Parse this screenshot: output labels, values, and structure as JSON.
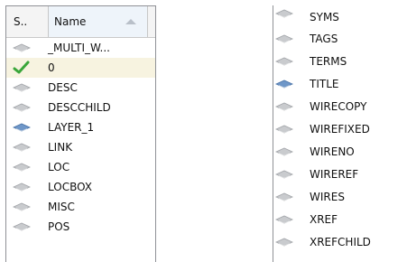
{
  "left_panel": {
    "columns": {
      "status": "S..",
      "name": "Name"
    },
    "rows": [
      {
        "name": "_MULTI_W...",
        "icon": "gray-layer-icon"
      },
      {
        "name": "0",
        "icon": "green-check-icon",
        "selected": true
      },
      {
        "name": "DESC",
        "icon": "gray-layer-icon"
      },
      {
        "name": "DESCCHILD",
        "icon": "gray-layer-icon"
      },
      {
        "name": "LAYER_1",
        "icon": "blue-layer-icon"
      },
      {
        "name": "LINK",
        "icon": "gray-layer-icon"
      },
      {
        "name": "LOC",
        "icon": "gray-layer-icon"
      },
      {
        "name": "LOCBOX",
        "icon": "gray-layer-icon"
      },
      {
        "name": "MISC",
        "icon": "gray-layer-icon"
      },
      {
        "name": "POS",
        "icon": "gray-layer-icon"
      }
    ]
  },
  "right_panel": {
    "rows": [
      {
        "name": "SYMS",
        "icon": "gray-layer-icon"
      },
      {
        "name": "TAGS",
        "icon": "gray-layer-icon"
      },
      {
        "name": "TERMS",
        "icon": "gray-layer-icon"
      },
      {
        "name": "TITLE",
        "icon": "blue-layer-icon"
      },
      {
        "name": "WIRECOPY",
        "icon": "gray-layer-icon"
      },
      {
        "name": "WIREFIXED",
        "icon": "gray-layer-icon"
      },
      {
        "name": "WIRENO",
        "icon": "gray-layer-icon"
      },
      {
        "name": "WIREREF",
        "icon": "gray-layer-icon"
      },
      {
        "name": "WIRES",
        "icon": "gray-layer-icon"
      },
      {
        "name": "XREF",
        "icon": "gray-layer-icon"
      },
      {
        "name": "XREFCHILD",
        "icon": "gray-layer-icon"
      }
    ]
  },
  "colors": {
    "selected_row": "#f7f3e0",
    "check": "#3aa63a",
    "blue_layer": "#6f97c8",
    "gray_layer": "#c9cbce"
  }
}
